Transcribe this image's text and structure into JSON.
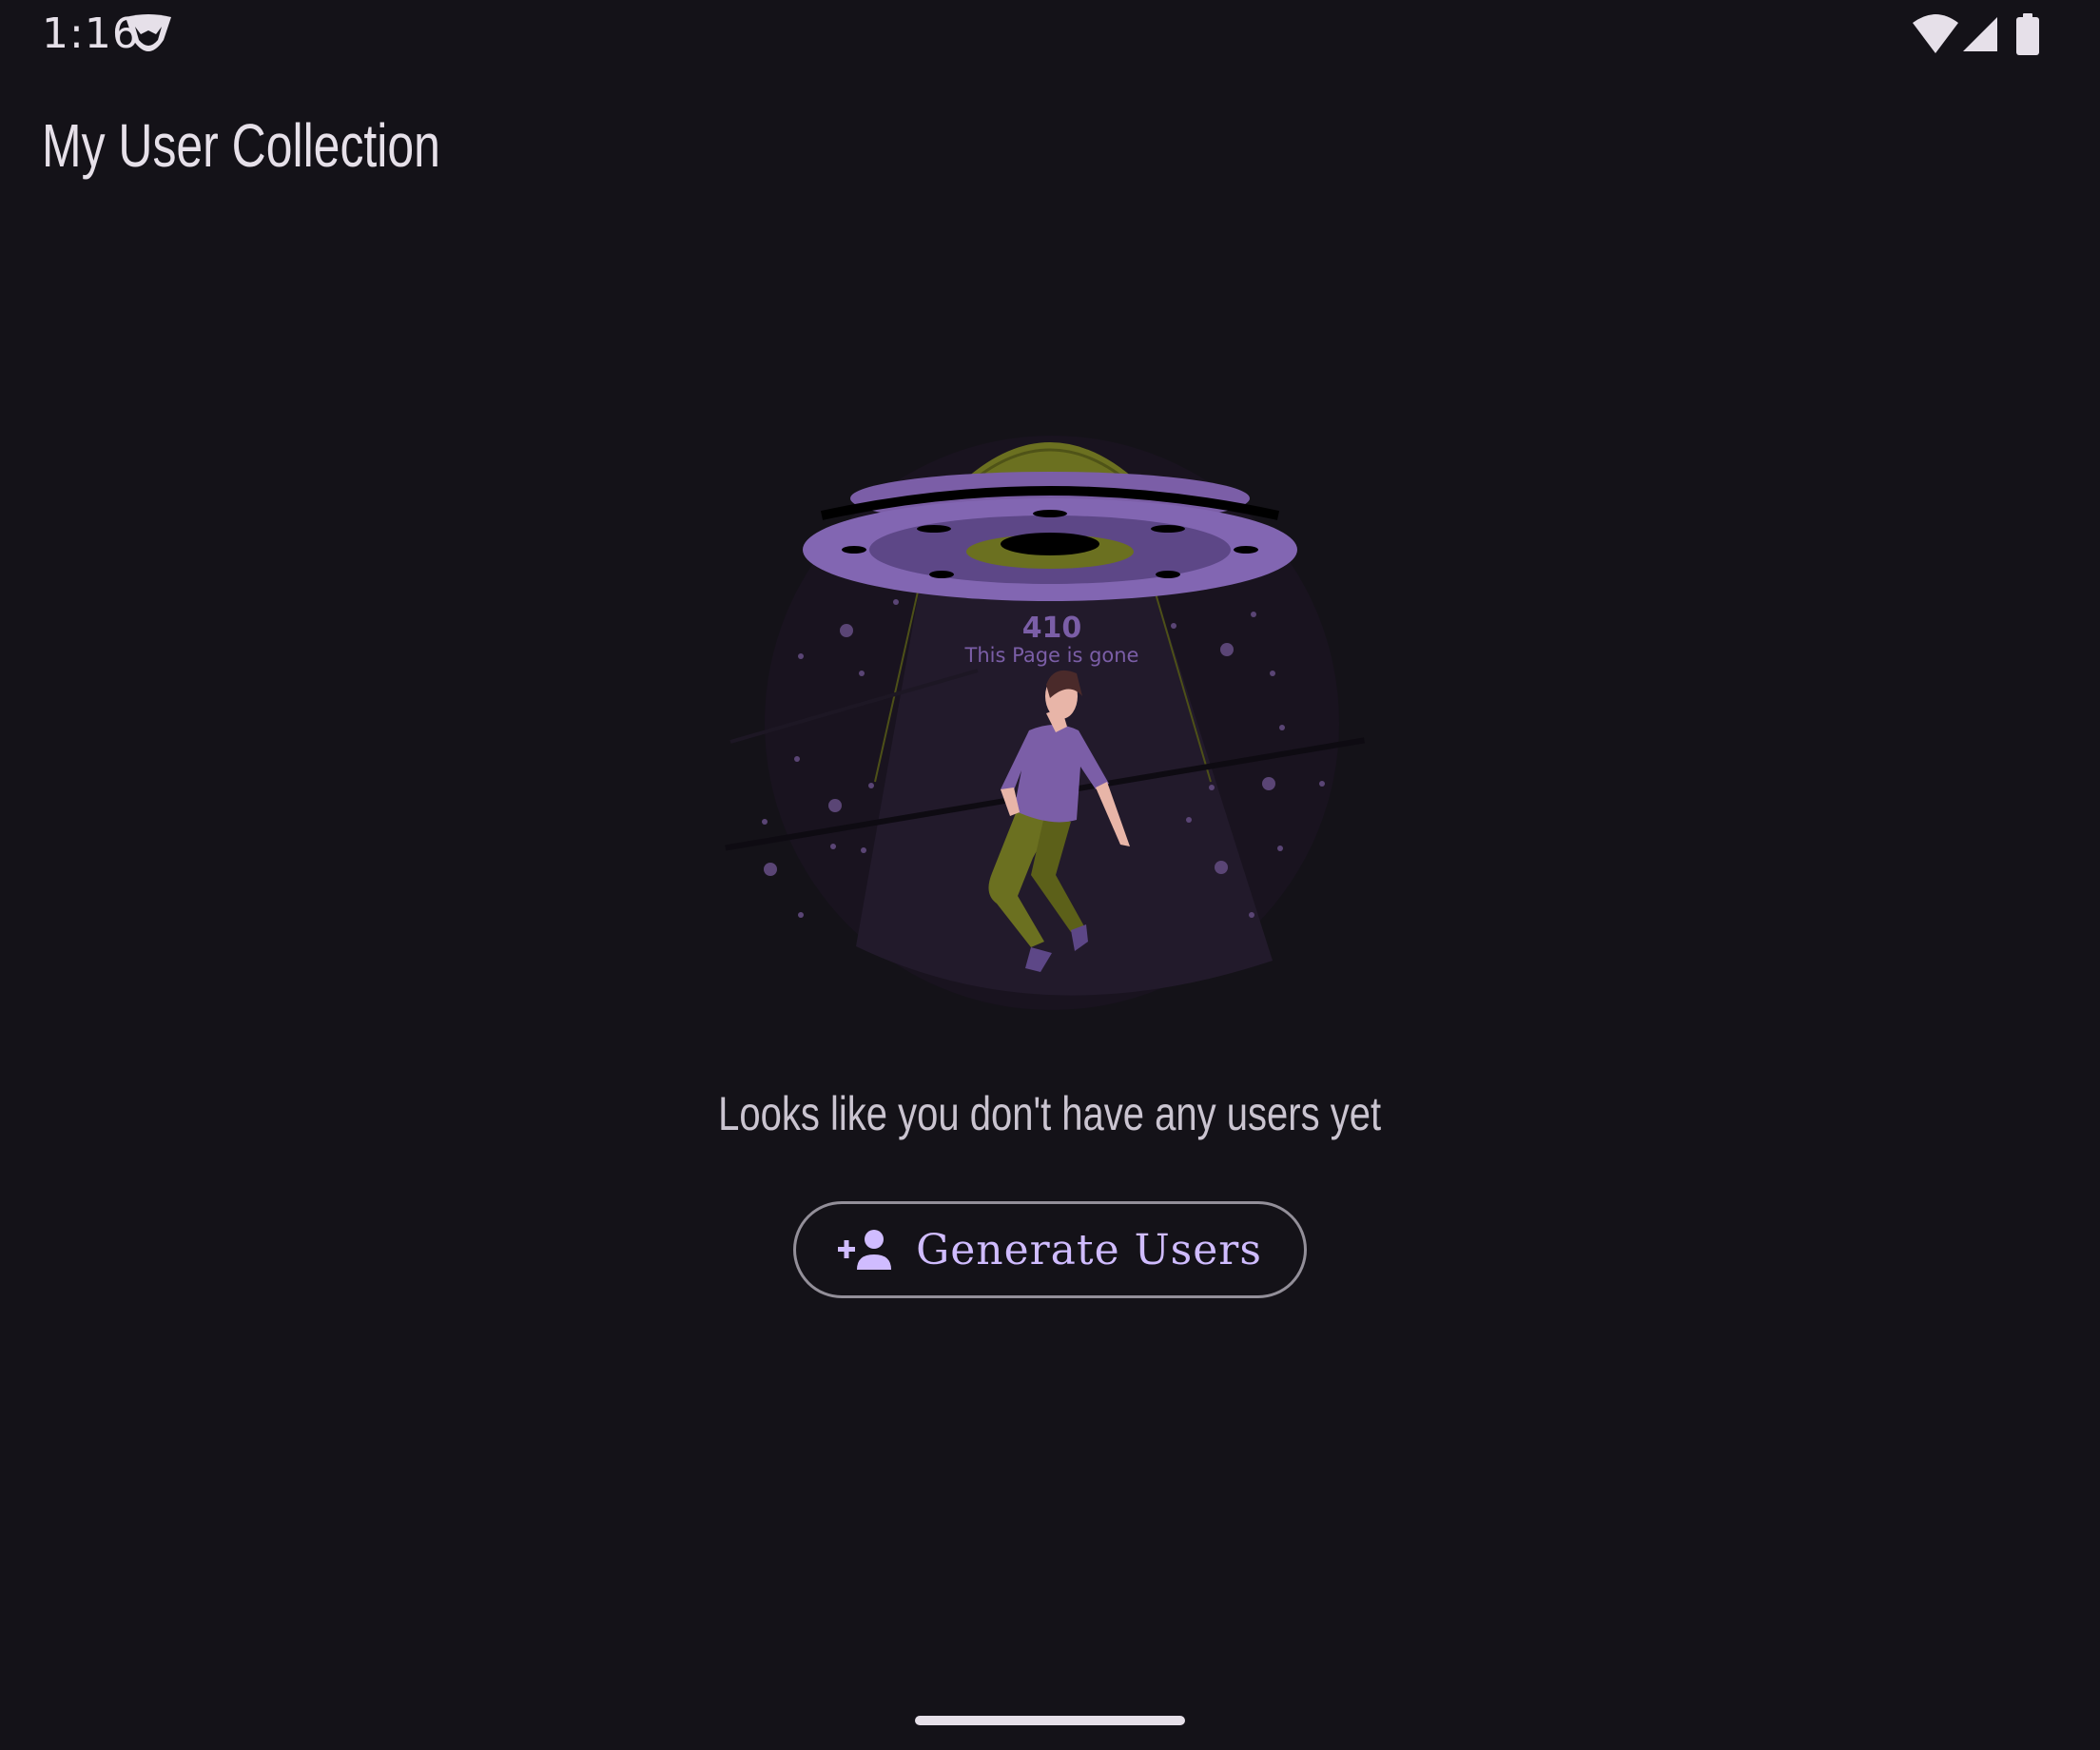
{
  "status_bar": {
    "time": "1:16",
    "icons": [
      "notification-icon",
      "wifi-icon",
      "signal-icon",
      "battery-icon"
    ]
  },
  "app_bar": {
    "title": "My User Collection"
  },
  "empty_state": {
    "illustration": {
      "code": "410",
      "caption": "This Page is gone"
    },
    "message": "Looks like you don't have any users yet",
    "button": {
      "label": "Generate Users",
      "icon": "person-add-icon"
    }
  },
  "colors": {
    "background": "#141218",
    "on_surface": "#e6e0e9",
    "primary": "#d0bcff",
    "outline": "#938f99",
    "ufo_purple": "#7b5ea7",
    "ufo_olive": "#6b7020"
  }
}
